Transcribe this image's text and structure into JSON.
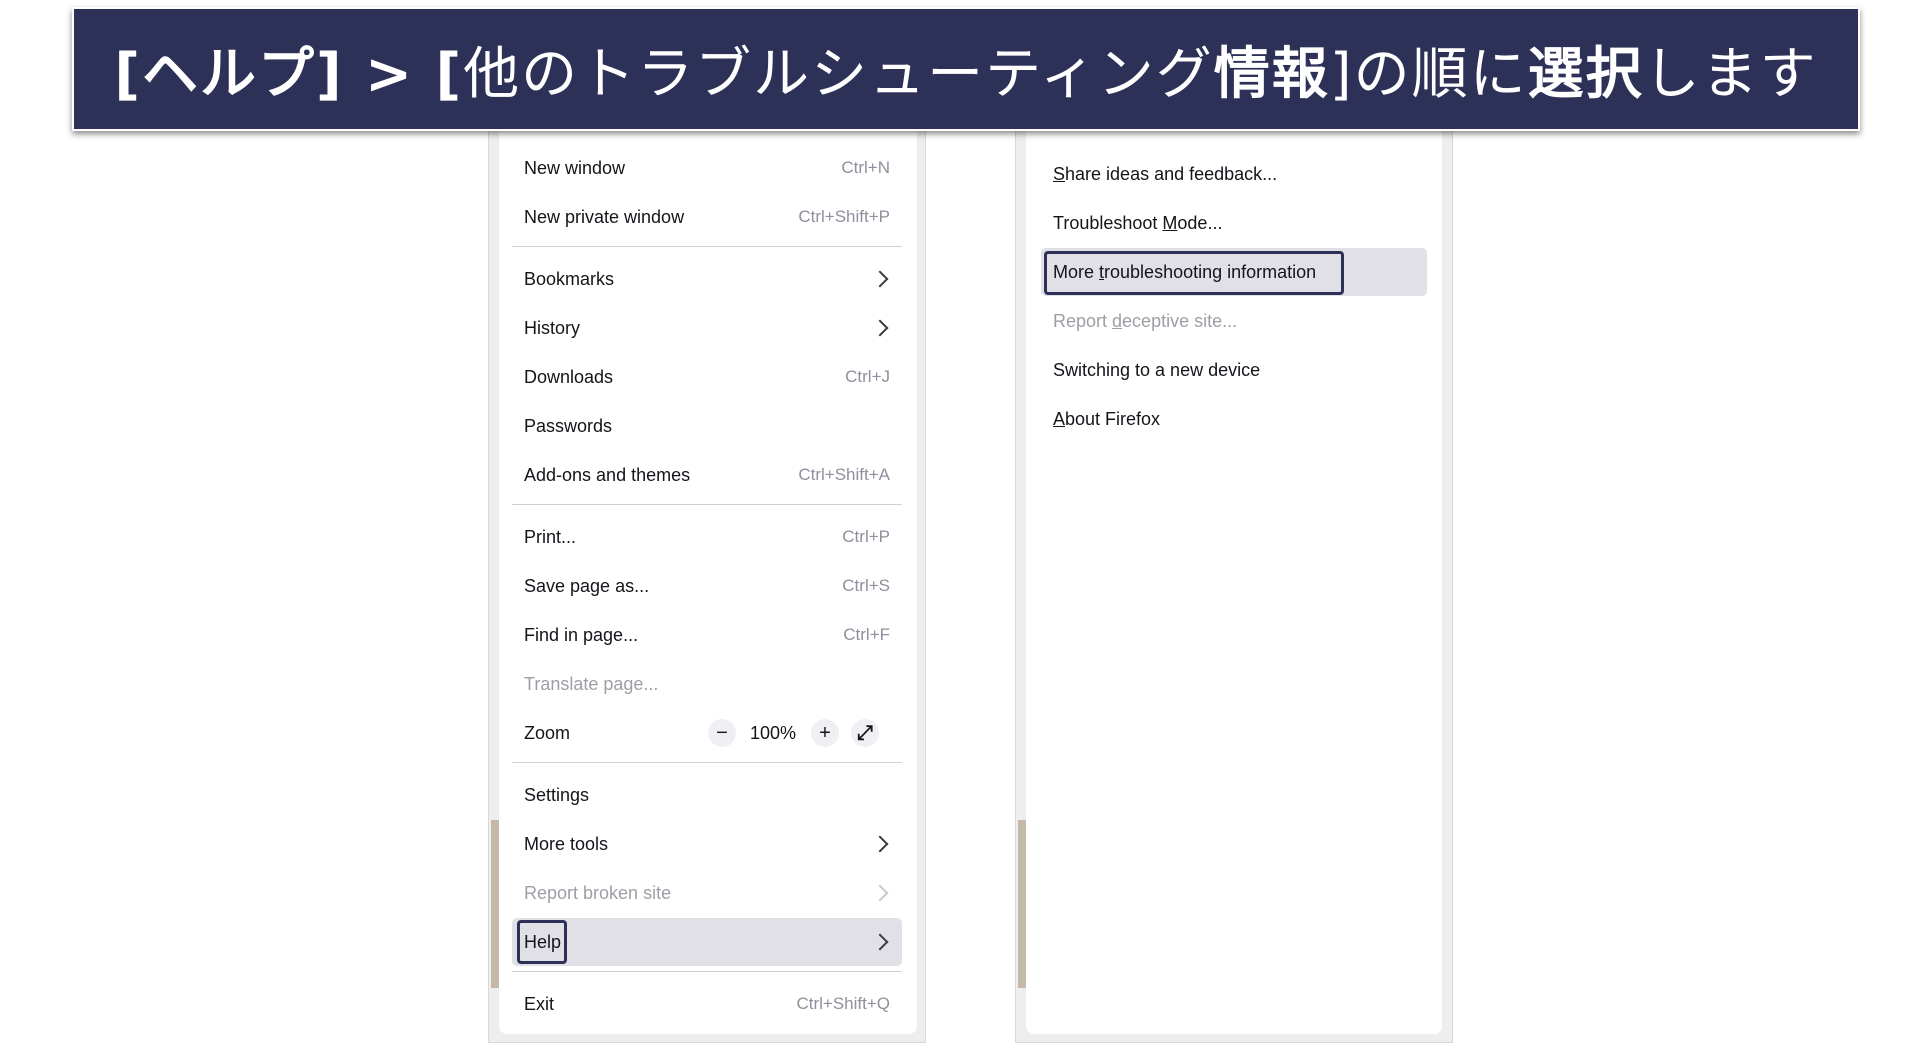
{
  "banner": {
    "part1": "[ヘルプ] > [",
    "part2": "他のトラブルシューティング",
    "part3": "情報",
    "part4": "]の順に",
    "part5": "選択",
    "part6": "します"
  },
  "main_menu": {
    "new_window": {
      "label": "New window",
      "shortcut": "Ctrl+N"
    },
    "new_private_window": {
      "label": "New private window",
      "shortcut": "Ctrl+Shift+P"
    },
    "bookmarks": {
      "label": "Bookmarks"
    },
    "history": {
      "label": "History"
    },
    "downloads": {
      "label": "Downloads",
      "shortcut": "Ctrl+J"
    },
    "passwords": {
      "label": "Passwords"
    },
    "addons": {
      "label": "Add-ons and themes",
      "shortcut": "Ctrl+Shift+A"
    },
    "print": {
      "label": "Print...",
      "shortcut": "Ctrl+P"
    },
    "save_page": {
      "label": "Save page as...",
      "shortcut": "Ctrl+S"
    },
    "find_in_page": {
      "label": "Find in page...",
      "shortcut": "Ctrl+F"
    },
    "translate_page": {
      "label": "Translate page..."
    },
    "zoom": {
      "label": "Zoom",
      "minus": "−",
      "level": "100%",
      "plus": "+",
      "fullscreen": "⤢"
    },
    "settings": {
      "label": "Settings"
    },
    "more_tools": {
      "label": "More tools"
    },
    "report_broken_site": {
      "label": "Report broken site"
    },
    "help": {
      "label": "Help"
    },
    "exit": {
      "label": "Exit",
      "shortcut": "Ctrl+Shift+Q"
    }
  },
  "help_menu": {
    "share_ideas": {
      "label_first": "S",
      "label_rest": "hare ideas and feedback..."
    },
    "troubleshoot_mode": {
      "label_pre": "Troubleshoot ",
      "label_key": "M",
      "label_post": "ode..."
    },
    "more_troubleshooting": {
      "label_pre": "More ",
      "label_key": "t",
      "label_post": "roubleshooting information"
    },
    "report_deceptive": {
      "label_pre": "Report ",
      "label_key": "d",
      "label_post": "eceptive site..."
    },
    "switching_device": {
      "label": "Switching to a new device"
    },
    "about_firefox": {
      "label_key": "A",
      "label_post": "bout Firefox"
    }
  },
  "icons": [
    "chevron-right-icon",
    "zoom-out-icon",
    "zoom-in-icon",
    "fullscreen-icon"
  ],
  "colors": {
    "banner_bg": "#2e3157",
    "highlight_bg": "#e0e0e6",
    "focus_border": "#2e3157"
  }
}
